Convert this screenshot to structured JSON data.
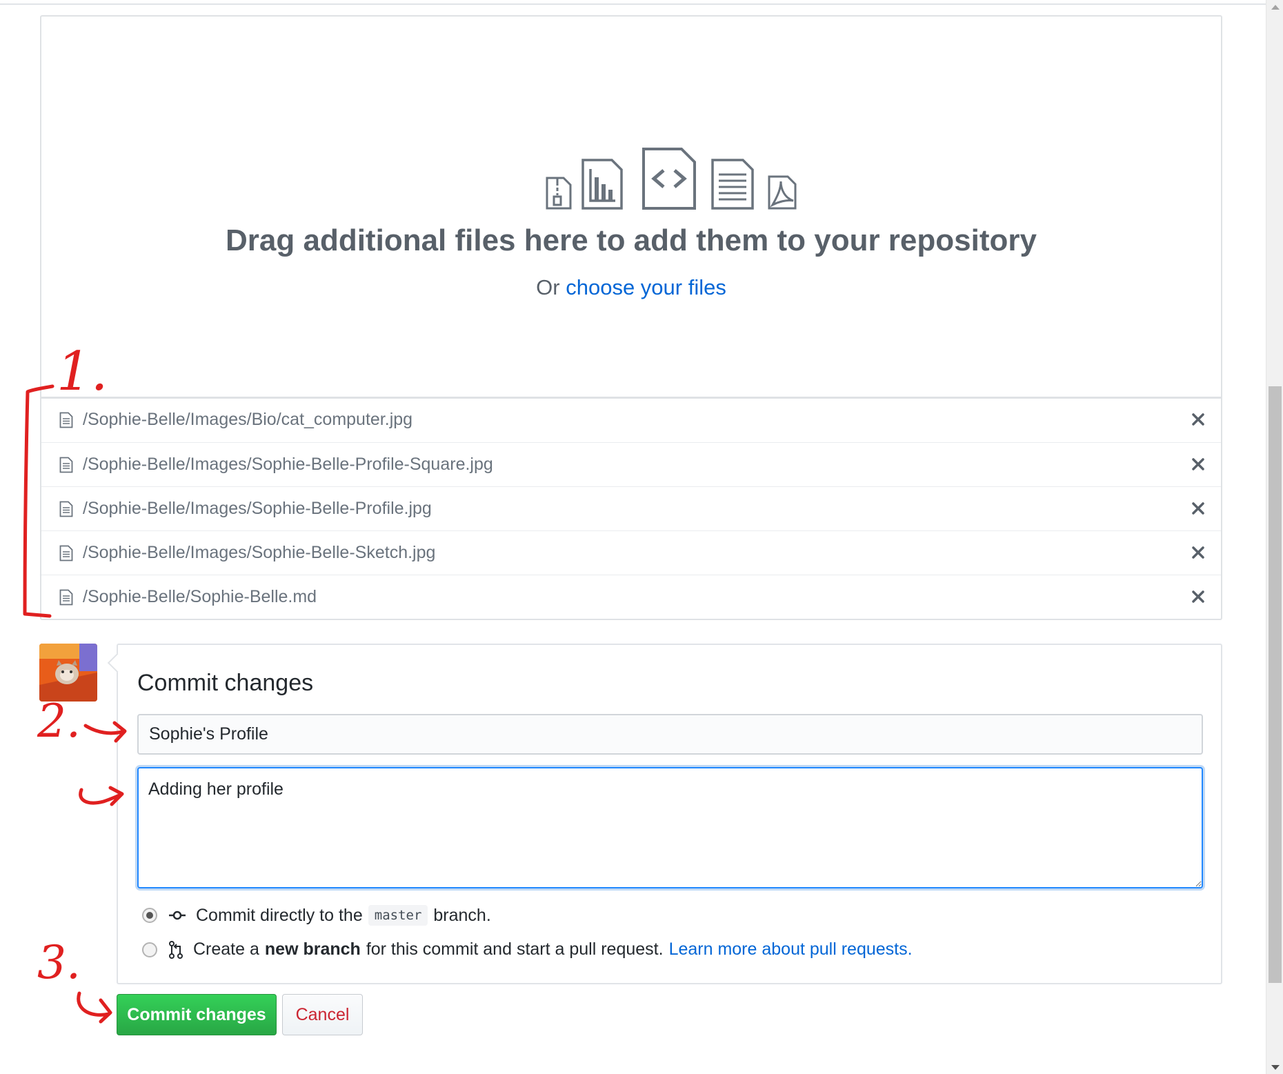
{
  "dropzone": {
    "heading": "Drag additional files here to add them to your repository",
    "sub_prefix": "Or",
    "sub_link": "choose your files",
    "icons": [
      "file-zip-icon",
      "graph-file-icon",
      "file-code-icon",
      "file-text-icon",
      "file-pdf-icon"
    ]
  },
  "files": [
    {
      "path": "/Sophie-Belle/Images/Bio/cat_computer.jpg"
    },
    {
      "path": "/Sophie-Belle/Images/Sophie-Belle-Profile-Square.jpg"
    },
    {
      "path": "/Sophie-Belle/Images/Sophie-Belle-Profile.jpg"
    },
    {
      "path": "/Sophie-Belle/Images/Sophie-Belle-Sketch.jpg"
    },
    {
      "path": "/Sophie-Belle/Sophie-Belle.md"
    }
  ],
  "commit": {
    "title": "Commit changes",
    "summary_value": "Sophie's Profile",
    "description_value": "Adding her profile",
    "option_direct": {
      "prefix": "Commit directly to the",
      "branch": "master",
      "suffix": "branch.",
      "selected": true
    },
    "option_new_branch": {
      "prefix": "Create a",
      "bold": "new branch",
      "suffix": "for this commit and start a pull request.",
      "link": "Learn more about pull requests.",
      "selected": false
    }
  },
  "buttons": {
    "commit_label": "Commit changes",
    "cancel_label": "Cancel"
  },
  "annotations": [
    "1.",
    "2.",
    "3."
  ],
  "colors": {
    "link": "#0366d6",
    "primary_button": "#28a745",
    "cancel_text": "#cb2431",
    "annotation_red": "#e02020",
    "focus_border": "#2188ff"
  }
}
